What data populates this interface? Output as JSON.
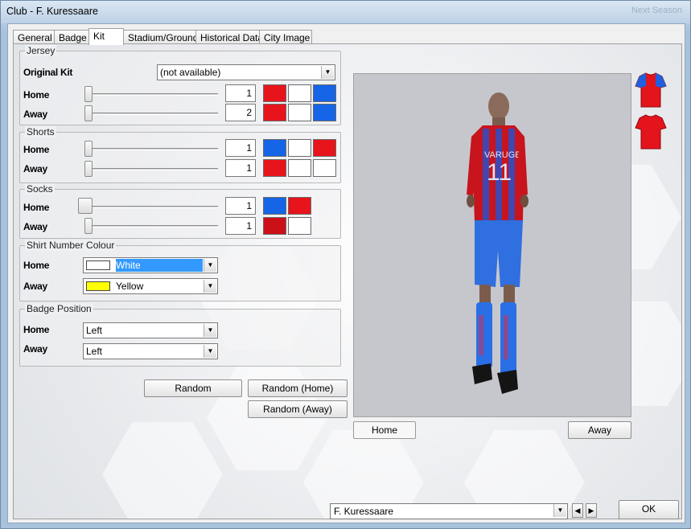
{
  "window": {
    "title": "Club - F. Kuressaare",
    "blurred_right_text": "Next Season"
  },
  "tabs": [
    {
      "label": "General"
    },
    {
      "label": "Badge"
    },
    {
      "label": "Kit"
    },
    {
      "label": "Stadium/Ground"
    },
    {
      "label": "Historical Data"
    },
    {
      "label": "City Image"
    }
  ],
  "jersey": {
    "legend": "Jersey",
    "original_kit_label": "Original Kit",
    "original_kit_value": "(not available)",
    "home": {
      "label": "Home",
      "value": "1",
      "slider_level": 0.0,
      "colors": [
        "#e8141c",
        "#ffffff",
        "#1565e6"
      ]
    },
    "away": {
      "label": "Away",
      "value": "2",
      "slider_level": 0.0,
      "colors": [
        "#e8141c",
        "#ffffff",
        "#1565e6"
      ]
    }
  },
  "shorts": {
    "legend": "Shorts",
    "home": {
      "label": "Home",
      "value": "1",
      "colors": [
        "#1565e6",
        "#ffffff",
        "#e8141c"
      ]
    },
    "away": {
      "label": "Away",
      "value": "1",
      "colors": [
        "#e8141c",
        "#ffffff",
        "#ffffff"
      ]
    }
  },
  "socks": {
    "legend": "Socks",
    "home": {
      "label": "Home",
      "value": "1",
      "colors": [
        "#1565e6",
        "#e8141c"
      ]
    },
    "away": {
      "label": "Away",
      "value": "1",
      "colors": [
        "#cc1018",
        "#ffffff"
      ]
    }
  },
  "shirt_number_colour": {
    "legend": "Shirt Number Colour",
    "home": {
      "label": "Home",
      "value": "White",
      "chip": "#ffffff"
    },
    "away": {
      "label": "Away",
      "value": "Yellow",
      "chip": "#ffff00"
    }
  },
  "badge_position": {
    "legend": "Badge Position",
    "home": {
      "label": "Home",
      "value": "Left"
    },
    "away": {
      "label": "Away",
      "value": "Left"
    }
  },
  "buttons": {
    "random": "Random",
    "random_home": "Random (Home)",
    "random_away": "Random (Away)",
    "preview_home": "Home",
    "preview_away": "Away",
    "ok": "OK"
  },
  "player": {
    "shirt_name": "VARUGE",
    "shirt_number": "11"
  },
  "club_selector": {
    "value": "F. Kuressaare"
  },
  "colors": {
    "kit_red": "#e8141c",
    "kit_blue": "#1565e6",
    "selection": "#3399ff"
  }
}
